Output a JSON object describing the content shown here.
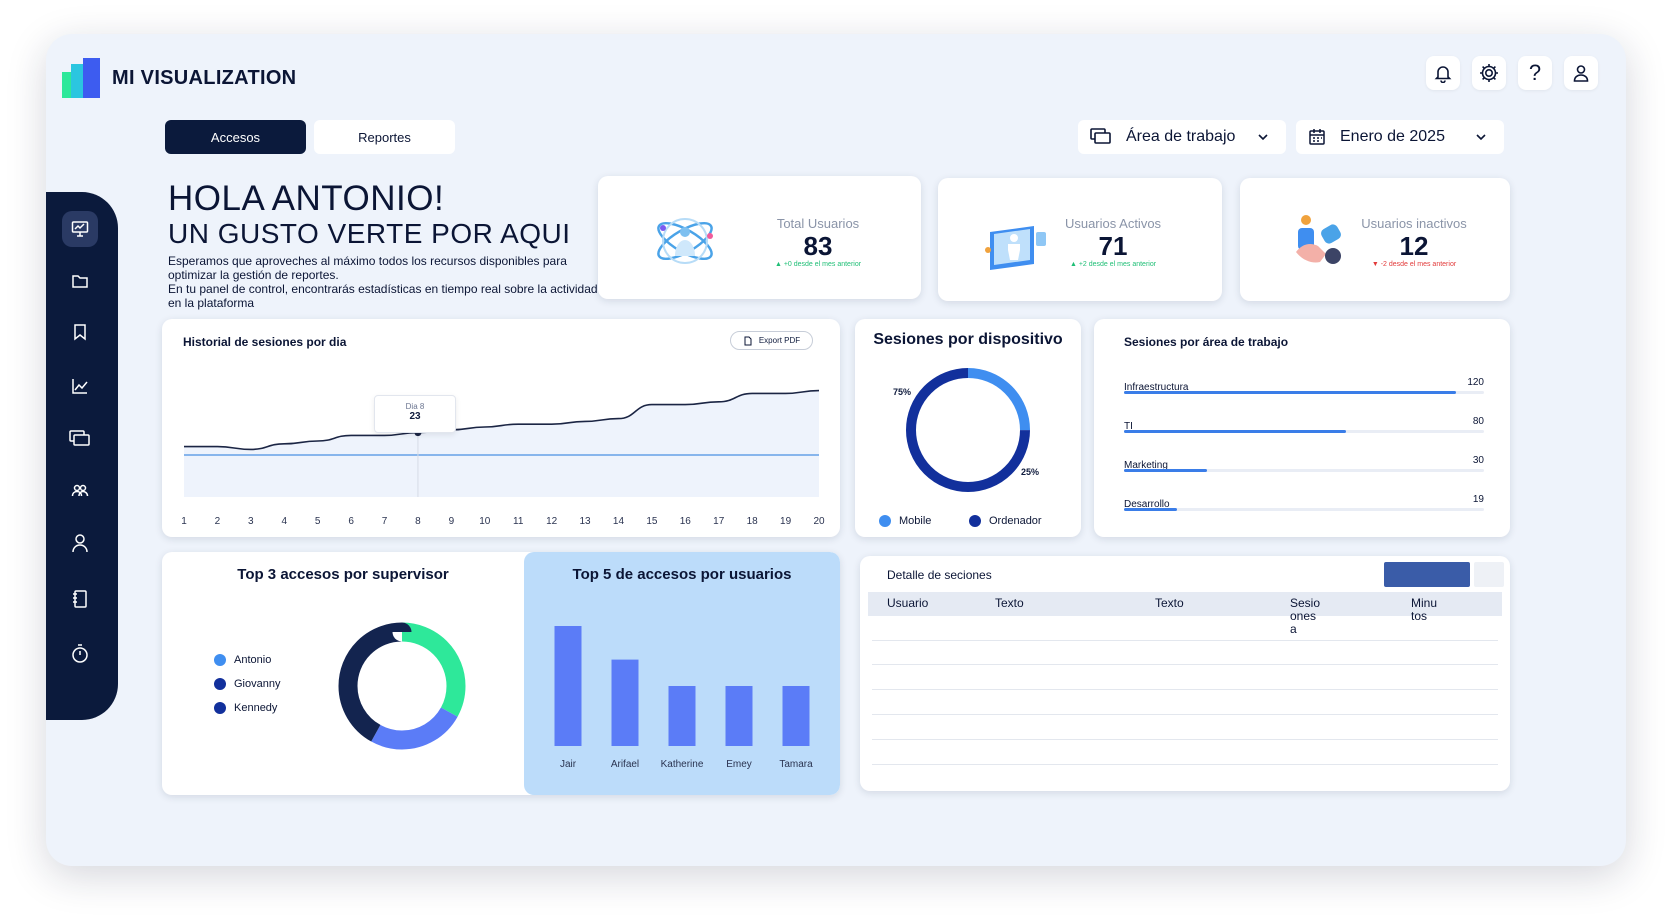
{
  "app": {
    "title": "MI VISUALIZATION"
  },
  "tabs": [
    {
      "label": "Accesos",
      "active": true
    },
    {
      "label": "Reportes",
      "active": false
    }
  ],
  "filters": {
    "workspace": "Área de trabajo",
    "date": "Enero de 2025"
  },
  "top_icons": [
    "bell-icon",
    "gear-icon",
    "help-icon",
    "user-icon"
  ],
  "sidebar": {
    "icons": [
      "presentation-icon",
      "folder-icon",
      "bookmark-icon",
      "line-chart-icon",
      "screens-icon",
      "users-icon",
      "user-icon",
      "notebook-icon",
      "timer-icon"
    ]
  },
  "greeting": {
    "title": "HOLA ANTONIO!",
    "subtitle": "UN GUSTO VERTE POR AQUI",
    "body1": "Esperamos que aproveches al máximo todos los recursos disponibles para optimizar la gestión de reportes.",
    "body2": "En tu panel de control, encontrarás estadísticas en tiempo real sobre la actividad en la plataforma"
  },
  "stats": [
    {
      "label": "Total Usuarios",
      "value": "83",
      "delta": "+0 desde el mes anterior",
      "trend": "up"
    },
    {
      "label": "Usuarios Activos",
      "value": "71",
      "delta": "+2 desde el mes anterior",
      "trend": "up"
    },
    {
      "label": "Usuarios inactivos",
      "value": "12",
      "delta": "-2 desde el mes anterior",
      "trend": "down"
    }
  ],
  "history": {
    "title": "Historial de sesiones por dia",
    "export_label": "Export PDF",
    "tooltip_label": "Dia 8",
    "tooltip_value": "23"
  },
  "device": {
    "title": "Sesiones por dispositivo",
    "label_a": "75%",
    "label_b": "25%",
    "legend_a": "Mobile",
    "legend_b": "Ordenador"
  },
  "workspace_sessions": {
    "title": "Sesiones por área de trabajo",
    "rows": [
      {
        "label": "Infraestructura",
        "value": "120"
      },
      {
        "label": "TI",
        "value": "80"
      },
      {
        "label": "Marketing",
        "value": "30"
      },
      {
        "label": "Desarrollo",
        "value": "19"
      }
    ]
  },
  "supervisor": {
    "title": "Top 3 accesos por supervisor",
    "legend": [
      "Antonio",
      "Giovanny",
      "Kennedy"
    ]
  },
  "top_users": {
    "title": "Top 5 de accesos por usuarios"
  },
  "detail": {
    "title": "Detalle de seciones",
    "columns": [
      "Usuario",
      "Texto",
      "Texto",
      "Sesio ones a",
      "Minu tos"
    ]
  },
  "colors": {
    "navy": "#0b1a3c",
    "blue": "#3a7de8",
    "bar_blue": "#5b7cf7",
    "green": "#2ee89a",
    "light_panel": "#bcdcfa"
  },
  "chart_data": [
    {
      "type": "line",
      "title": "Historial de sesiones por dia",
      "x": [
        1,
        2,
        3,
        4,
        5,
        6,
        7,
        8,
        9,
        10,
        11,
        12,
        13,
        14,
        15,
        16,
        17,
        18,
        19,
        20
      ],
      "series": [
        {
          "values": [
            18,
            18,
            17,
            19,
            20,
            22,
            22,
            23,
            24,
            25,
            26,
            26,
            27,
            28,
            33,
            33,
            34,
            37,
            37,
            38
          ]
        }
      ],
      "ylim": [
        0,
        45
      ],
      "grid": false
    },
    {
      "type": "pie",
      "title": "Sesiones por dispositivo",
      "labels": [
        "Mobile",
        "Ordenador"
      ],
      "values": [
        25,
        75
      ],
      "colors": [
        "#3f8ef0",
        "#12309c"
      ]
    },
    {
      "type": "bar",
      "title": "Sesiones por área de trabajo",
      "categories": [
        "Infraestructura",
        "TI",
        "Marketing",
        "Desarrollo"
      ],
      "values": [
        120,
        80,
        30,
        19
      ],
      "xlim": [
        0,
        130
      ]
    },
    {
      "type": "pie",
      "title": "Top 3 accesos por supervisor",
      "labels": [
        "Antonio",
        "Giovanny",
        "Kennedy"
      ],
      "values": [
        33,
        25,
        42
      ],
      "colors": [
        "#2ee89a",
        "#5b7cf7",
        "#13244f"
      ]
    },
    {
      "type": "bar",
      "title": "Top 5 de accesos por usuarios",
      "categories": [
        "Jair",
        "Arifael",
        "Katherine",
        "Emey",
        "Tamara"
      ],
      "values": [
        100,
        72,
        50,
        50,
        50
      ],
      "ylim": [
        0,
        110
      ],
      "color": "#5b7cf7"
    }
  ]
}
